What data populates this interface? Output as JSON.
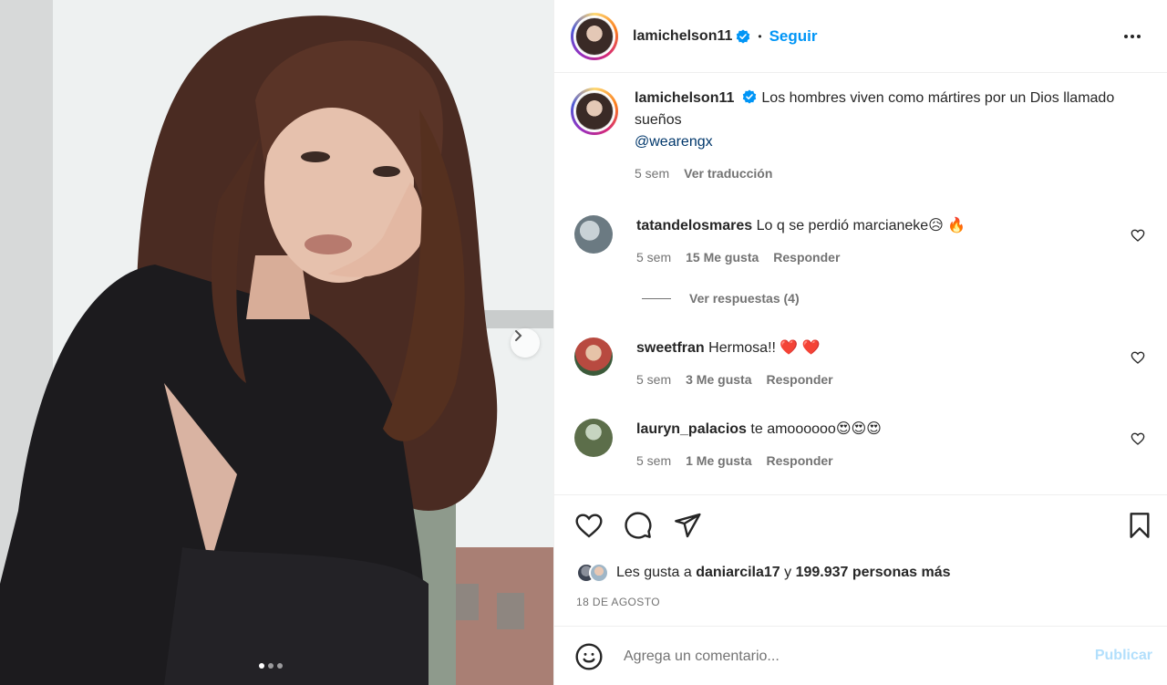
{
  "post": {
    "author": "lamichelson11",
    "follow_label": "Seguir",
    "bullet": "•",
    "caption": "Los hombres viven como mártires por un Dios llamado sueños",
    "mention": "@wearengx",
    "time": "5 sem",
    "translate_label": "Ver traducción",
    "carousel": {
      "slides": 3,
      "active": 1
    }
  },
  "comments": [
    {
      "user": "tatandelosmares",
      "text": "Lo q se perdió marcianeke😥 🔥",
      "time": "5 sem",
      "likes": "15 Me gusta",
      "reply": "Responder",
      "avatar_color": "#6b7a82"
    },
    {
      "user": "sweetfran",
      "text": "Hermosa!! ❤️ ❤️",
      "time": "5 sem",
      "likes": "3 Me gusta",
      "reply": "Responder",
      "avatar_color": "#b84a40"
    },
    {
      "user": "lauryn_palacios",
      "text": "te amoooooo😍😍😍",
      "time": "5 sem",
      "likes": "1 Me gusta",
      "reply": "Responder",
      "avatar_color": "#5c6e4a"
    }
  ],
  "replies_label": "Ver respuestas (4)",
  "likes": {
    "prefix": "Les gusta a",
    "user": "daniarcila17",
    "middle": "y",
    "count": "199.937 personas más"
  },
  "date": "18 DE AGOSTO",
  "add_comment": {
    "placeholder": "Agrega un comentario...",
    "publish_label": "Publicar"
  },
  "icons": {
    "more": "more-horizontal-icon",
    "like": "heart-icon",
    "comment": "comment-bubble-icon",
    "share": "paper-plane-icon",
    "save": "bookmark-icon",
    "emoji": "emoji-smile-icon",
    "verified": "verified-badge-icon",
    "next": "chevron-right-icon"
  },
  "colors": {
    "accent": "#0095f6",
    "verified": "#0095f6",
    "publish_disabled": "#b2dffc",
    "mention": "#00376b"
  }
}
